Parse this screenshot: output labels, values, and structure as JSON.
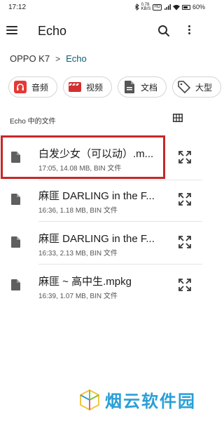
{
  "status_bar": {
    "time": "17:12",
    "network_speed": "0.78",
    "network_unit": "KB/S",
    "hd_badge": "HD",
    "battery": "60%"
  },
  "app_bar": {
    "title": "Echo",
    "menu_icon": "hamburger-menu-icon",
    "search_icon": "search-icon",
    "more_icon": "more-vert-icon"
  },
  "breadcrumb": {
    "root": "OPPO K7",
    "separator": ">",
    "current": "Echo"
  },
  "chips": [
    {
      "label": "音频",
      "icon": "audio-icon",
      "color": "#e53935"
    },
    {
      "label": "视频",
      "icon": "video-icon",
      "color": "#d32f2f"
    },
    {
      "label": "文档",
      "icon": "document-icon",
      "color": "#555555"
    },
    {
      "label": "大型",
      "icon": "tag-icon",
      "color": "#555555"
    }
  ],
  "section": {
    "title": "Echo 中的文件",
    "view_icon": "grid-view-icon"
  },
  "files": [
    {
      "name": "白发少女（可以动）.m...",
      "meta": "17:05, 14.08 MB, BIN 文件"
    },
    {
      "name": "麻匪 DARLING in the F...",
      "meta": "16:36, 1.18 MB, BIN 文件"
    },
    {
      "name": "麻匪 DARLING in the F...",
      "meta": "16:33, 2.13 MB, BIN 文件"
    },
    {
      "name": "麻匪 ~ 高中生.mpkg",
      "meta": "16:39, 1.07 MB, BIN 文件"
    }
  ],
  "watermark": {
    "text": "烟云软件园"
  },
  "colors": {
    "accent": "#0b5c73",
    "highlight": "#c62828",
    "watermark": "#2a9fd6"
  }
}
